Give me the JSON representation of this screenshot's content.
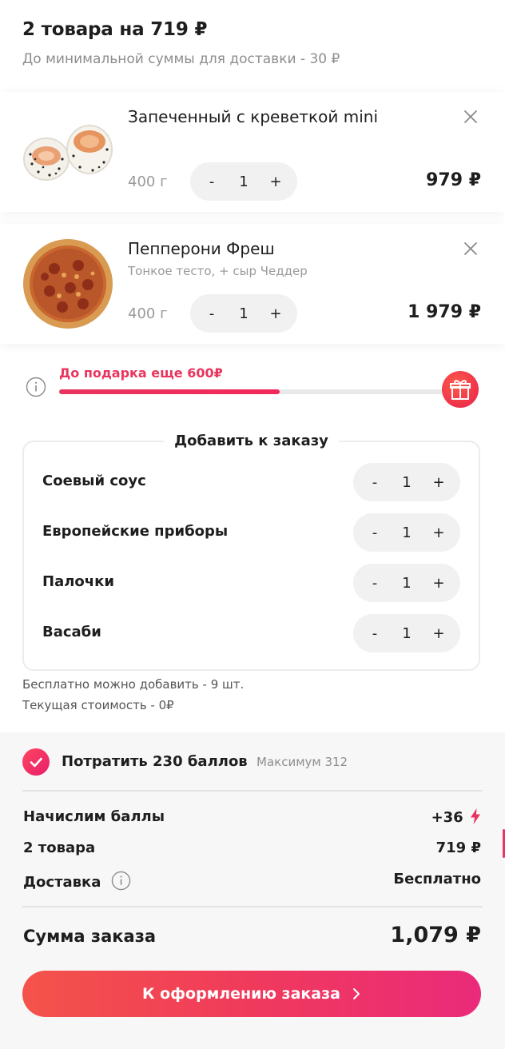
{
  "header": {
    "title": "2 товара на 719 ₽",
    "subtitle": "До минимальной суммы для доставки - 30 ₽"
  },
  "cart_items": [
    {
      "name": "Запеченный с креветкой mini",
      "description": "",
      "weight": "400 г",
      "qty": "1",
      "minus": "-",
      "plus": "+",
      "price": "979 ₽"
    },
    {
      "name": "Пепперони Фреш",
      "description": "Тонкое тесто, + сыр Чеддер",
      "weight": "400 г",
      "qty": "1",
      "minus": "-",
      "plus": "+",
      "price": "1 979 ₽"
    }
  ],
  "gift_progress": {
    "text": "До подарка еще 600₽",
    "progress": 0.53
  },
  "addons": {
    "title": "Добавить к заказу",
    "items": [
      {
        "label": "Соевый соус",
        "minus": "-",
        "qty": "1",
        "plus": "+"
      },
      {
        "label": "Европейские приборы",
        "minus": "-",
        "qty": "1",
        "plus": "+"
      },
      {
        "label": "Палочки",
        "minus": "-",
        "qty": "1",
        "plus": "+"
      },
      {
        "label": "Васаби",
        "minus": "-",
        "qty": "1",
        "plus": "+"
      }
    ],
    "free_note": "Бесплатно можно добавить - 9 шт.",
    "cost_note": "Текущая стоимость - 0₽"
  },
  "summary": {
    "spend_label": "Потратить 230 баллов",
    "spend_max": "Максимум 312",
    "accrue_label": "Начислим баллы",
    "accrue_value": "+36",
    "items_label": "2 товара",
    "items_value": "719 ₽",
    "delivery_label": "Доставка",
    "delivery_value": "Бесплатно",
    "total_label": "Сумма заказа",
    "total_value": "1,079 ₽",
    "checkout_label": "К оформлению заказа"
  },
  "colors": {
    "accent": "#e8355f",
    "cta_start": "#f4534a",
    "cta_end": "#ea2a7a"
  }
}
